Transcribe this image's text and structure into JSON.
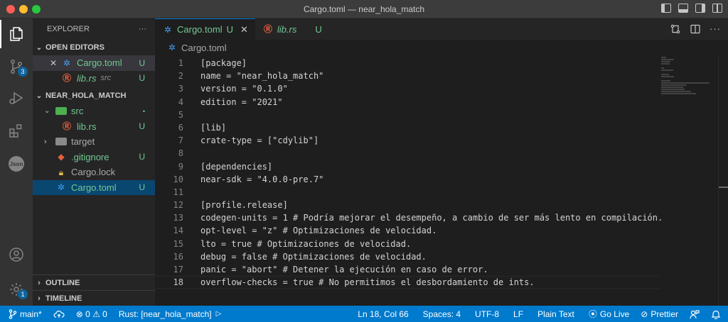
{
  "window": {
    "title": "Cargo.toml — near_hola_match"
  },
  "activity_bar": {
    "source_control_badge": "3",
    "settings_badge": "1",
    "json_label": "Json"
  },
  "explorer": {
    "title": "EXPLORER",
    "more": "···",
    "open_editors": {
      "label": "OPEN EDITORS",
      "items": [
        {
          "name": "Cargo.toml",
          "status": "U",
          "close": "✕"
        },
        {
          "name": "lib.rs",
          "hint": "src",
          "status": "U"
        }
      ]
    },
    "project": {
      "label": "NEAR_HOLA_MATCH",
      "items": [
        {
          "name": "src",
          "status": "•"
        },
        {
          "name": "lib.rs",
          "status": "U"
        },
        {
          "name": "target"
        },
        {
          "name": ".gitignore",
          "status": "U"
        },
        {
          "name": "Cargo.lock"
        },
        {
          "name": "Cargo.toml",
          "status": "U"
        }
      ]
    },
    "outline": "OUTLINE",
    "timeline": "TIMELINE"
  },
  "tabs": [
    {
      "name": "Cargo.toml",
      "status": "U",
      "close": "✕"
    },
    {
      "name": "lib.rs",
      "status": "U"
    }
  ],
  "breadcrumb": "Cargo.toml",
  "code_lines": [
    {
      "n": "1",
      "t": "[package]"
    },
    {
      "n": "2",
      "t": "name = \"near_hola_match\""
    },
    {
      "n": "3",
      "t": "version = \"0.1.0\""
    },
    {
      "n": "4",
      "t": "edition = \"2021\""
    },
    {
      "n": "5",
      "t": ""
    },
    {
      "n": "6",
      "t": "[lib]"
    },
    {
      "n": "7",
      "t": "crate-type = [\"cdylib\"]"
    },
    {
      "n": "8",
      "t": ""
    },
    {
      "n": "9",
      "t": "[dependencies]"
    },
    {
      "n": "10",
      "t": "near-sdk = \"4.0.0-pre.7\""
    },
    {
      "n": "11",
      "t": ""
    },
    {
      "n": "12",
      "t": "[profile.release]"
    },
    {
      "n": "13",
      "t": "codegen-units = 1 # Podría mejorar el desempeño, a cambio de ser más lento en compilación."
    },
    {
      "n": "14",
      "t": "opt-level = \"z\" # Optimizaciones de velocidad."
    },
    {
      "n": "15",
      "t": "lto = true # Optimizaciones de velocidad."
    },
    {
      "n": "16",
      "t": "debug = false # Optimizaciones de velocidad."
    },
    {
      "n": "17",
      "t": "panic = \"abort\" # Detener la ejecución en caso de error."
    },
    {
      "n": "18",
      "t": "overflow-checks = true # No permitimos el desbordamiento de ints."
    }
  ],
  "statusbar": {
    "branch": "main*",
    "problems": "⊗ 0 ⚠ 0",
    "rust": "Rust: [near_hola_match]",
    "position": "Ln 18, Col 66",
    "spaces": "Spaces: 4",
    "encoding": "UTF-8",
    "eol": "LF",
    "language": "Plain Text",
    "golive": "Go Live",
    "prettier": "Prettier"
  },
  "colors": {
    "accent": "#007acc",
    "untracked": "#73c991",
    "rust": "#e8603f",
    "toml_gear": "#4a9ff5"
  }
}
